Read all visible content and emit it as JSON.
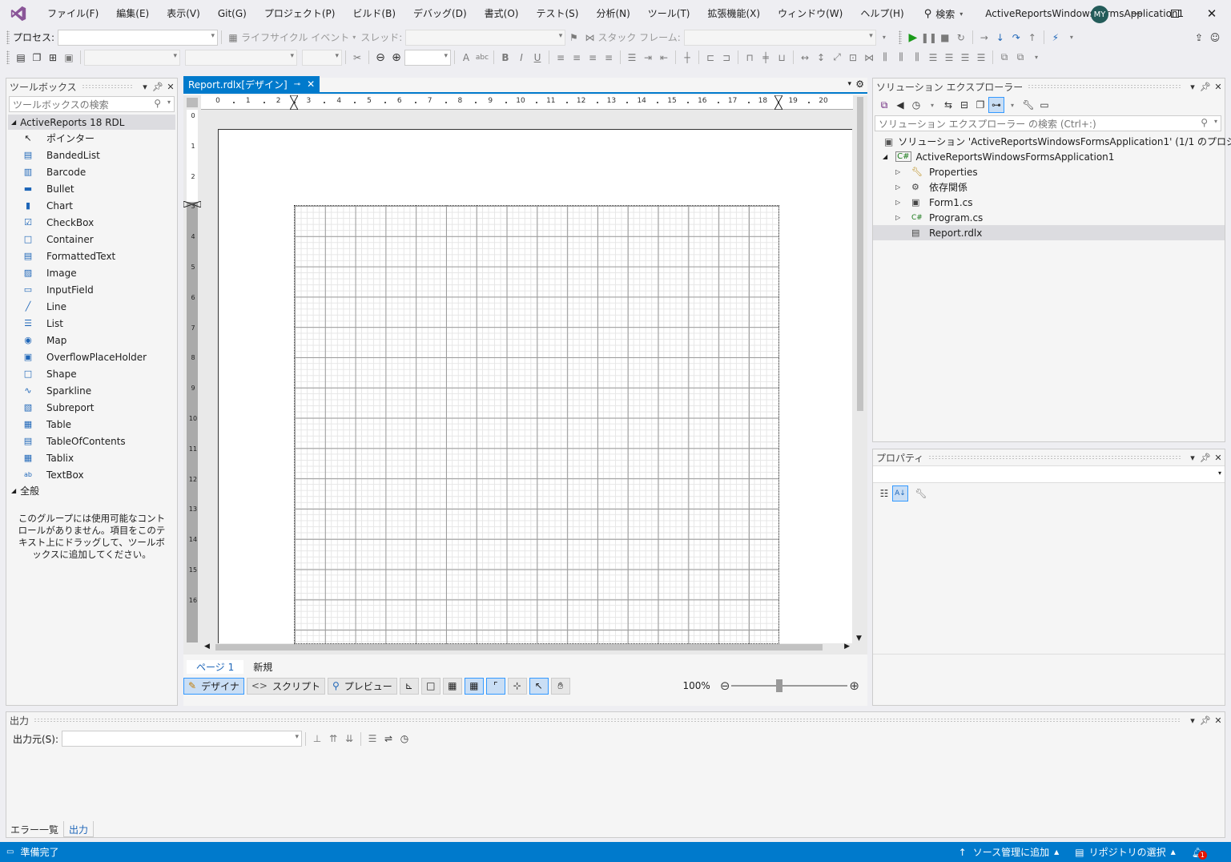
{
  "menu": [
    "ファイル(F)",
    "編集(E)",
    "表示(V)",
    "Git(G)",
    "プロジェクト(P)",
    "ビルド(B)",
    "デバッグ(D)",
    "書式(O)",
    "テスト(S)",
    "分析(N)",
    "ツール(T)",
    "拡張機能(X)",
    "ウィンドウ(W)",
    "ヘルプ(H)"
  ],
  "search_label": "検索",
  "app_title": "ActiveReportsWindowsFormsApplication1",
  "avatar_initials": "MY",
  "toolbar1": {
    "process_label": "プロセス:",
    "lifecycle_label": "ライフサイクル イベント",
    "thread_label": "スレッド:",
    "stackframe_label": "スタック フレーム:"
  },
  "toolbox": {
    "title": "ツールボックス",
    "search_placeholder": "ツールボックスの検索",
    "group_name": "ActiveReports 18 RDL",
    "items": [
      "ポインター",
      "BandedList",
      "Barcode",
      "Bullet",
      "Chart",
      "CheckBox",
      "Container",
      "FormattedText",
      "Image",
      "InputField",
      "Line",
      "List",
      "Map",
      "OverflowPlaceHolder",
      "Shape",
      "Sparkline",
      "Subreport",
      "Table",
      "TableOfContents",
      "Tablix",
      "TextBox"
    ],
    "general_group": "全般",
    "empty_message": "このグループには使用可能なコントロールがありません。項目をこのテキスト上にドラッグして、ツールボックスに追加してください。"
  },
  "document_tab": "Report.rdlx[デザイン]",
  "ruler_h": [
    "0",
    "1",
    "2",
    "3",
    "4",
    "5",
    "6",
    "7",
    "8",
    "9",
    "10",
    "11",
    "12",
    "13",
    "14",
    "15",
    "16",
    "17",
    "18",
    "19",
    "20"
  ],
  "ruler_v": [
    "0",
    "1",
    "2",
    "3",
    "4",
    "5",
    "6",
    "7",
    "8",
    "9",
    "10",
    "11",
    "12",
    "13",
    "14",
    "15",
    "16"
  ],
  "page_tabs": [
    "ページ 1",
    "新規"
  ],
  "designer_buttons": {
    "design": "デザイナ",
    "script": "スクリプト",
    "preview": "プレビュー"
  },
  "zoom": "100%",
  "solution_explorer": {
    "title": "ソリューション エクスプローラー",
    "search_placeholder": "ソリューション エクスプローラー の検索 (Ctrl+:)",
    "solution": "ソリューション 'ActiveReportsWindowsFormsApplication1' (1/1 のプロジェクト)",
    "project": "ActiveReportsWindowsFormsApplication1",
    "children": [
      "Properties",
      "依存関係",
      "Form1.cs",
      "Program.cs",
      "Report.rdlx"
    ]
  },
  "properties": {
    "title": "プロパティ"
  },
  "output": {
    "title": "出力",
    "source_label": "出力元(S):"
  },
  "bottom_tabs": [
    "エラー一覧",
    "出力"
  ],
  "status": {
    "ready": "準備完了",
    "source_control": "ソース管理に追加",
    "repo": "リポジトリの選択",
    "notifications": "1"
  },
  "colors": {
    "accent": "#007acc",
    "status_bar": "#007acc",
    "avatar": "#245c5a"
  }
}
